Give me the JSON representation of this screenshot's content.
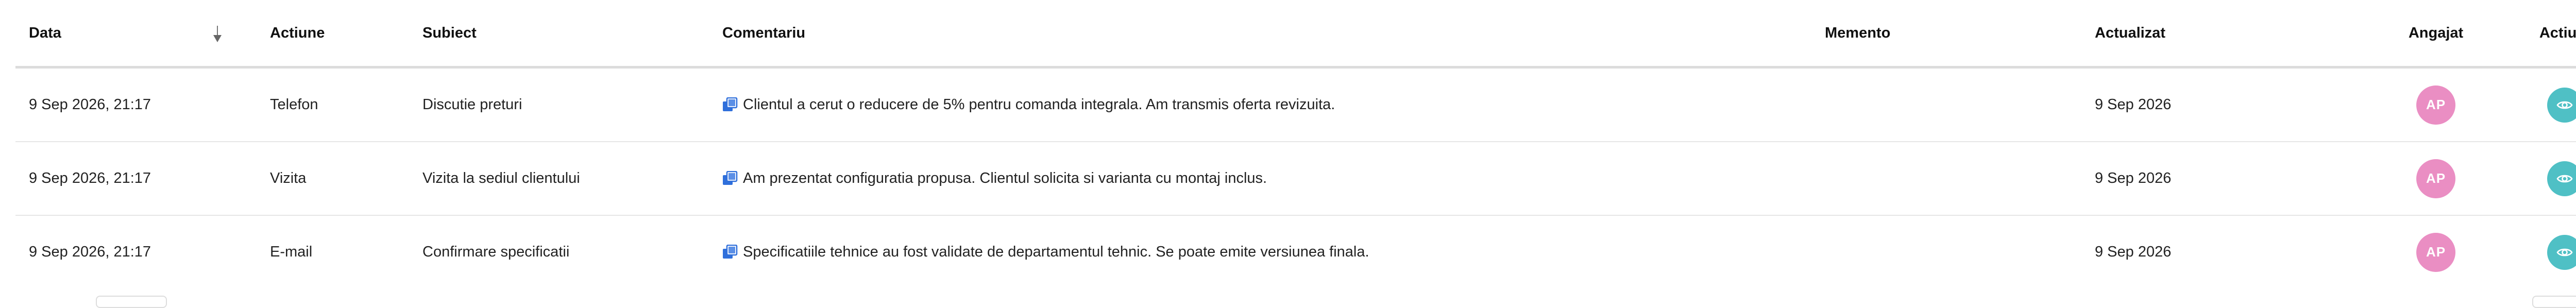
{
  "table": {
    "columns": {
      "data": "Data",
      "actiune": "Actiune",
      "subiect": "Subiect",
      "comentariu": "Comentariu",
      "memento": "Memento",
      "actualizat": "Actualizat",
      "angajat": "Angajat",
      "actiuni": "Actiuni"
    },
    "sort_icon": "sort-down-icon",
    "rows": [
      {
        "data": "9 Sep 2026, 21:17",
        "actiune": "Telefon",
        "subiect": "Discutie preturi",
        "comentariu": "Clientul a cerut o reducere de 5% pentru comanda integrala. Am transmis oferta revizuita.",
        "memento": "",
        "actualizat": "9 Sep 2026",
        "angajat": "AP"
      },
      {
        "data": "9 Sep 2026, 21:17",
        "actiune": "Vizita",
        "subiect": "Vizita la sediul clientului",
        "comentariu": "Am prezentat configuratia propusa. Clientul solicita si varianta cu montaj inclus.",
        "memento": "",
        "actualizat": "9 Sep 2026",
        "angajat": "AP"
      },
      {
        "data": "9 Sep 2026, 21:17",
        "actiune": "E-mail",
        "subiect": "Confirmare specificatii",
        "comentariu": "Specificatiile tehnice au fost validate de departamentul tehnic. Se poate emite versiunea finala.",
        "memento": "",
        "actualizat": "9 Sep 2026",
        "angajat": "AP"
      }
    ]
  },
  "colors": {
    "avatar": "#ea8ec3",
    "view_button": "#4fc0c5",
    "copy_icon": "#2f6fdb"
  }
}
